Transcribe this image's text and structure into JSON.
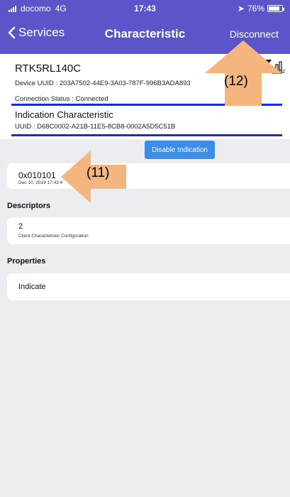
{
  "status_bar": {
    "carrier": "docomo",
    "network": "4G",
    "time": "17:43",
    "battery": "76%"
  },
  "nav": {
    "back_label": "Services",
    "title": "Characteristic",
    "disconnect_label": "Disconnect"
  },
  "device": {
    "name": "RTK5RL140C",
    "uuid": "Device UUID : 203A7502-44E9-3A03-787F-996B3ADA893",
    "connection_status": "Connection Status :   Connected",
    "rssi": "-52"
  },
  "characteristic": {
    "name": "Indication Characteristic",
    "uuid": "UUID : D68C0002-A21B-11E5-8CB8-0002A5D5C51B"
  },
  "indication_button_label": "Disable Indication",
  "value": {
    "text": "0x010101",
    "timestamp": "Dec 10, 2019 17:43:4"
  },
  "descriptors": {
    "header": "Descriptors",
    "items": [
      {
        "value": "2",
        "name": "Client Characteristic Configuration"
      }
    ]
  },
  "properties": {
    "header": "Properties",
    "items": [
      "Indicate"
    ]
  },
  "annotations": {
    "callout_11": "(11)",
    "callout_12": "(12)"
  },
  "colors": {
    "nav": "#5b55c9",
    "button": "#3d8ce8",
    "divider": "#1d2bd6",
    "arrow": "#f5b57e"
  }
}
